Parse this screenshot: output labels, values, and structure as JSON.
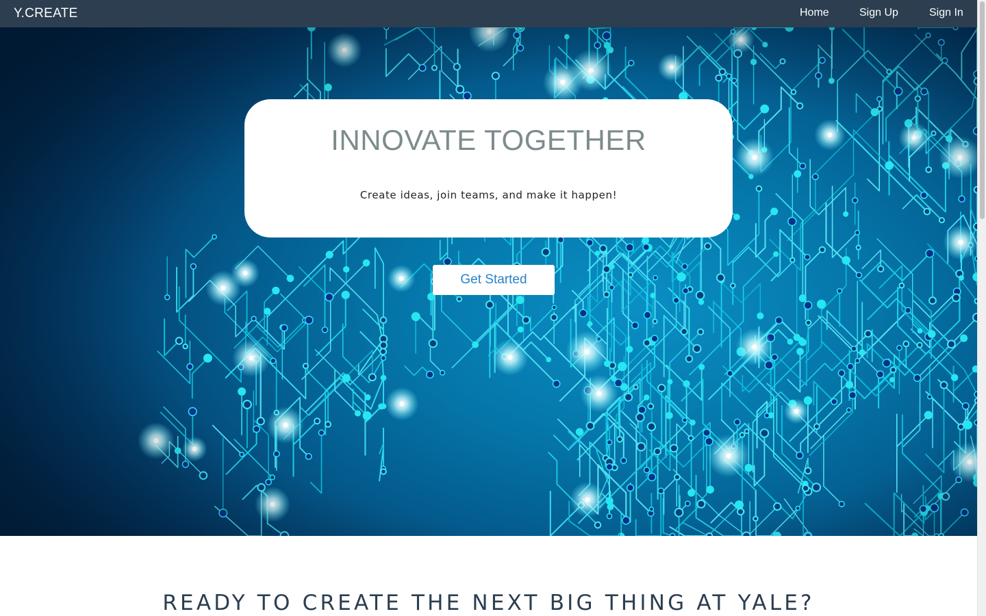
{
  "navbar": {
    "brand": "Y.CREATE",
    "links": {
      "home": "Home",
      "sign_up": "Sign Up",
      "sign_in": "Sign In"
    },
    "background": "#2c3e50"
  },
  "hero": {
    "background_image": "circuit-board",
    "title": "INNOVATE TOGETHER",
    "subtitle": "Create ideas, join teams, and make it happen!",
    "cta_label": "Get Started",
    "accent": "#2a82c9"
  },
  "section": {
    "heading": "READY TO CREATE THE NEXT BIG THING AT YALE?"
  }
}
